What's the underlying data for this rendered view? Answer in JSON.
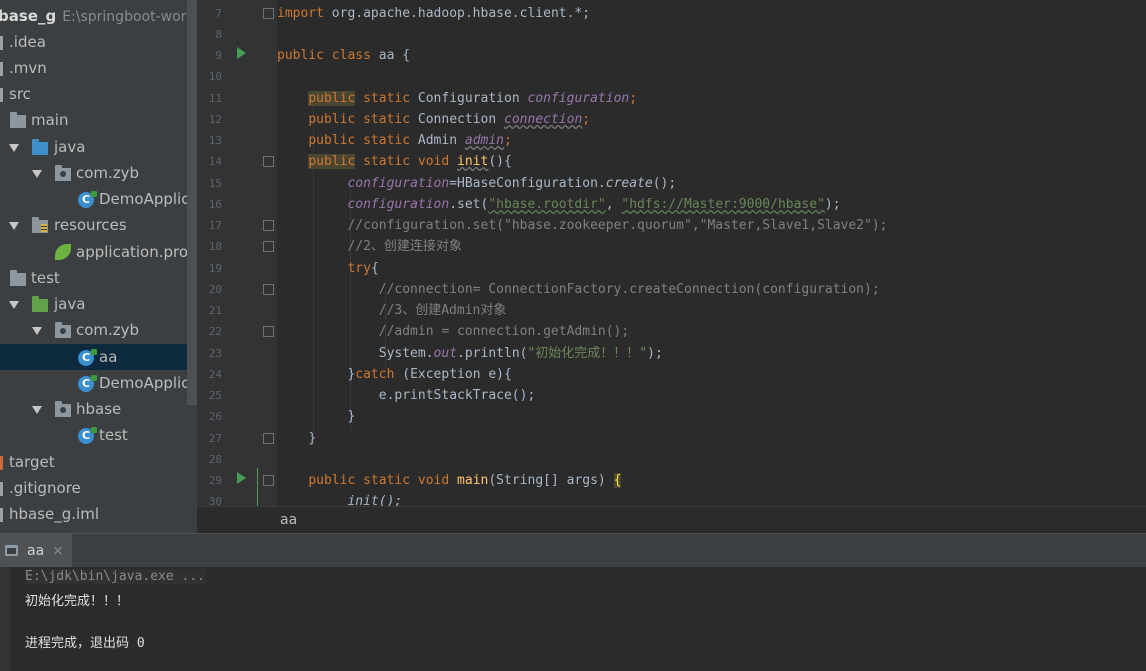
{
  "project": {
    "root_name": "base_g",
    "root_path": "E:\\springboot-work",
    "items": [
      {
        "label": "idea",
        "prefix": "."
      },
      {
        "label": "mvn",
        "prefix": "."
      },
      {
        "label": "src"
      },
      {
        "label": "main"
      },
      {
        "label": "java"
      },
      {
        "label": "com.zyb"
      },
      {
        "label": "DemoApplica"
      },
      {
        "label": "resources"
      },
      {
        "label": "application.prop"
      },
      {
        "label": "test"
      },
      {
        "label": "java"
      },
      {
        "label": "com.zyb"
      },
      {
        "label": "aa"
      },
      {
        "label": "DemoApplica"
      },
      {
        "label": "hbase"
      },
      {
        "label": "test"
      },
      {
        "label": "target"
      },
      {
        "label": ".gitignore"
      },
      {
        "label": "hbase_g.iml"
      }
    ],
    "class_icon_letter": "C"
  },
  "editor": {
    "line_numbers": [
      "7",
      "8",
      "9",
      "10",
      "11",
      "12",
      "13",
      "14",
      "15",
      "16",
      "17",
      "18",
      "19",
      "20",
      "21",
      "22",
      "23",
      "24",
      "25",
      "26",
      "27",
      "28",
      "29",
      "30"
    ],
    "code": {
      "l7_kw": "import",
      "l7_rest": " org.apache.hadoop.hbase.client.*;",
      "l9_kw": "public class",
      "l9_rest": " aa {",
      "kw_public": "public",
      "kw_static": "static",
      "kw_void": "void",
      "l11_type": "Configuration",
      "l11_field": "configuration",
      "l12_type": "Connection",
      "l12_field": "connection",
      "l13_type": "Admin",
      "l13_field": "admin",
      "l14_fn": "init",
      "l14_rest": "(){",
      "l15_field": "configuration",
      "l15_mid": "=HBaseConfiguration.",
      "l15_method": "create",
      "l15_end": "();",
      "l16_field": "configuration",
      "l16_mid": ".set(",
      "l16_s1": "\"hbase.rootdir\"",
      "l16_comma": ", ",
      "l16_s2": "\"hdfs://Master:9000/hbase\"",
      "l16_end": ");",
      "l17_comment": "//configuration.set(\"hbase.zookeeper.quorum\",\"Master,Slave1,Slave2\");",
      "l18_comment": "//2、创建连接对象",
      "l19_kw": "try",
      "l19_rest": "{",
      "l20_comment": "//connection= ConnectionFactory.createConnection(configuration);",
      "l21_comment": "//3、创建Admin对象",
      "l22_comment": "//admin = connection.getAdmin();",
      "l23_a": "System.",
      "l23_out": "out",
      "l23_b": ".println(",
      "l23_str": "\"初始化完成！！！\"",
      "l23_end": ");",
      "l24_a": "}",
      "l24_kw": "catch",
      "l24_rest": " (Exception e){",
      "l25": "e.printStackTrace();",
      "l26": "}",
      "l27": "}",
      "l29_fn": "main",
      "l29_rest": "(String[] args) ",
      "l29_brace": "{",
      "l30": "init();"
    },
    "breadcrumb": "aa"
  },
  "run_panel": {
    "tab_label": "aa",
    "close_glyph": "×",
    "console_lines": [
      "E:\\jdk\\bin\\java.exe ...",
      "初始化完成！！！",
      "",
      "进程完成，退出码 0"
    ]
  },
  "colors": {
    "keyword": "#cc7832",
    "string": "#6a8759",
    "comment": "#808080",
    "field": "#9876aa",
    "method": "#ffc66d",
    "selection": "#0d293e"
  }
}
